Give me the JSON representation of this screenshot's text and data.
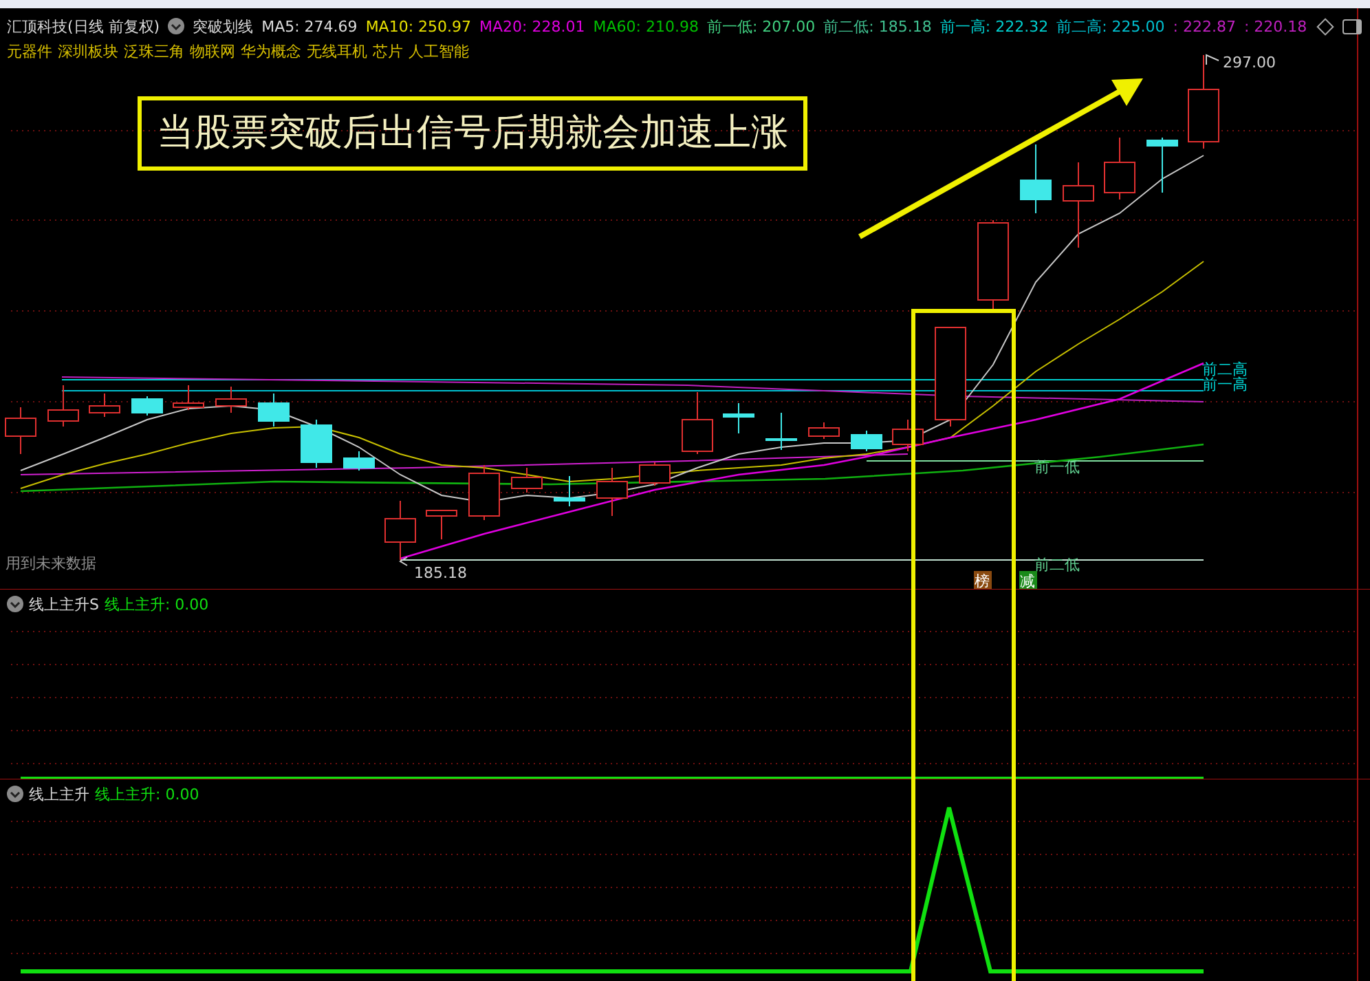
{
  "header": {
    "title": "汇顶科技(日线 前复权)",
    "indicator": "突破划线",
    "values": [
      {
        "text": "MA5: 274.69",
        "color": "#dcdcdc"
      },
      {
        "text": "MA10: 250.97",
        "color": "#e8e000"
      },
      {
        "text": "MA20: 228.01",
        "color": "#e000e0"
      },
      {
        "text": "MA60: 210.98",
        "color": "#00c000"
      },
      {
        "text": "前一低: 207.00",
        "color": "#40d080"
      },
      {
        "text": "前二低: 185.18",
        "color": "#40c090"
      },
      {
        "text": "前一高: 222.32",
        "color": "#00d0d0"
      },
      {
        "text": "前二高: 225.00",
        "color": "#00c0d0"
      },
      {
        "text": ": 222.87",
        "color": "#c020c0"
      },
      {
        "text": ": 220.18",
        "color": "#c020c0"
      }
    ]
  },
  "concepts": [
    "元器件",
    "深圳板块",
    "泛珠三角",
    "物联网",
    "华为概念",
    "无线耳机",
    "芯片",
    "人工智能"
  ],
  "annotation": "当股票突破后出信号后期就会加速上涨",
  "price_labels": {
    "high": "297.00",
    "low": "185.18"
  },
  "level_labels": [
    {
      "text": "前二高",
      "kind": "high"
    },
    {
      "text": "前一高",
      "kind": "high"
    },
    {
      "text": "前一低",
      "kind": "low"
    },
    {
      "text": "前二低",
      "kind": "low"
    }
  ],
  "markers": [
    {
      "text": "榜",
      "color": "#8a4a10"
    },
    {
      "text": "减",
      "color": "#1a8a1a"
    }
  ],
  "note": "用到未来数据",
  "panels": [
    {
      "title": "线上主升S",
      "value": "线上主升: 0.00",
      "kind": "flat"
    },
    {
      "title": "线上主升",
      "value": "线上主升: 0.00",
      "kind": "spike"
    }
  ]
}
